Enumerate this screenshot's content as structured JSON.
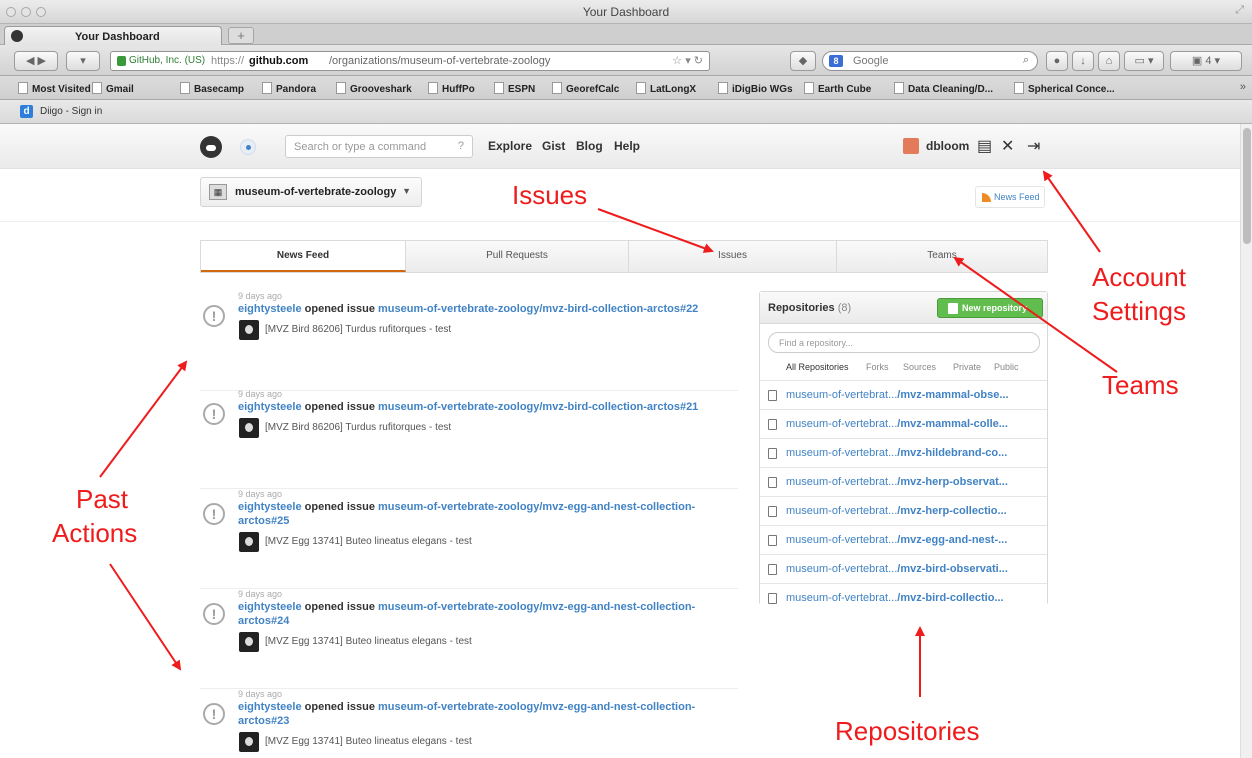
{
  "window": {
    "title": "Your Dashboard"
  },
  "tabs": {
    "active_label": "Your Dashboard",
    "new_tab": "+"
  },
  "address_bar": {
    "identity": "GitHub, Inc. (US)",
    "prefix": "https://",
    "host": "github.com",
    "path": "/organizations/museum-of-vertebrate-zoology"
  },
  "search_engine": {
    "placeholder": "Google",
    "badge": "8"
  },
  "bookmarks": [
    "Most Visited ▾",
    "Gmail",
    "Basecamp",
    "Pandora",
    "Grooveshark",
    "HuffPo",
    "ESPN",
    "GeorefCalc",
    "LatLongX",
    "iDigBio WGs",
    "Earth Cube",
    "Data Cleaning/D...",
    "Spherical Conce..."
  ],
  "diigo": {
    "label": "Diigo - Sign in"
  },
  "github": {
    "search_placeholder": "Search or type a command",
    "search_hint": "?",
    "nav": [
      "Explore",
      "Gist",
      "Blog",
      "Help"
    ],
    "username": "dbloom",
    "context": "museum-of-vertebrate-zoology",
    "news_feed_link": "News Feed",
    "dashboard_tabs": [
      "News Feed",
      "Pull Requests",
      "Issues",
      "Teams"
    ],
    "feed": [
      {
        "time": "9 days ago",
        "actor": "eightysteele",
        "action": "opened issue",
        "target": "museum-of-vertebrate-zoology/mvz-bird-collection-arctos#22",
        "message": "[MVZ Bird 86206] Turdus rufitorques - test"
      },
      {
        "time": "9 days ago",
        "actor": "eightysteele",
        "action": "opened issue",
        "target": "museum-of-vertebrate-zoology/mvz-bird-collection-arctos#21",
        "message": "[MVZ Bird 86206] Turdus rufitorques - test"
      },
      {
        "time": "9 days ago",
        "actor": "eightysteele",
        "action": "opened issue",
        "target": "museum-of-vertebrate-zoology/mvz-egg-and-nest-collection-arctos#25",
        "message": "[MVZ Egg 13741] Buteo lineatus elegans - test"
      },
      {
        "time": "9 days ago",
        "actor": "eightysteele",
        "action": "opened issue",
        "target": "museum-of-vertebrate-zoology/mvz-egg-and-nest-collection-arctos#24",
        "message": "[MVZ Egg 13741] Buteo lineatus elegans - test"
      },
      {
        "time": "9 days ago",
        "actor": "eightysteele",
        "action": "opened issue",
        "target": "museum-of-vertebrate-zoology/mvz-egg-and-nest-collection-arctos#23",
        "message": "[MVZ Egg 13741] Buteo lineatus elegans - test"
      }
    ],
    "repositories": {
      "title": "Repositories",
      "count": "(8)",
      "new_button": "New repository",
      "find_placeholder": "Find a repository...",
      "filters": [
        "All Repositories",
        "Forks",
        "Sources",
        "Private",
        "Public"
      ],
      "items": [
        {
          "owner": "museum-of-vertebrat...",
          "name": "/mvz-mammal-obse..."
        },
        {
          "owner": "museum-of-vertebrat...",
          "name": "/mvz-mammal-colle..."
        },
        {
          "owner": "museum-of-vertebrat...",
          "name": "/mvz-hildebrand-co..."
        },
        {
          "owner": "museum-of-vertebrat...",
          "name": "/mvz-herp-observat..."
        },
        {
          "owner": "museum-of-vertebrat...",
          "name": "/mvz-herp-collectio..."
        },
        {
          "owner": "museum-of-vertebrat...",
          "name": "/mvz-egg-and-nest-..."
        },
        {
          "owner": "museum-of-vertebrat...",
          "name": "/mvz-bird-observati..."
        },
        {
          "owner": "museum-of-vertebrat...",
          "name": "/mvz-bird-collectio..."
        }
      ]
    }
  },
  "annotations": {
    "issues": "Issues",
    "account_line1": "Account",
    "account_line2": "Settings",
    "teams": "Teams",
    "past_line1": "Past",
    "past_line2": "Actions",
    "repositories": "Repositories",
    "color": "#ee1c1c"
  }
}
